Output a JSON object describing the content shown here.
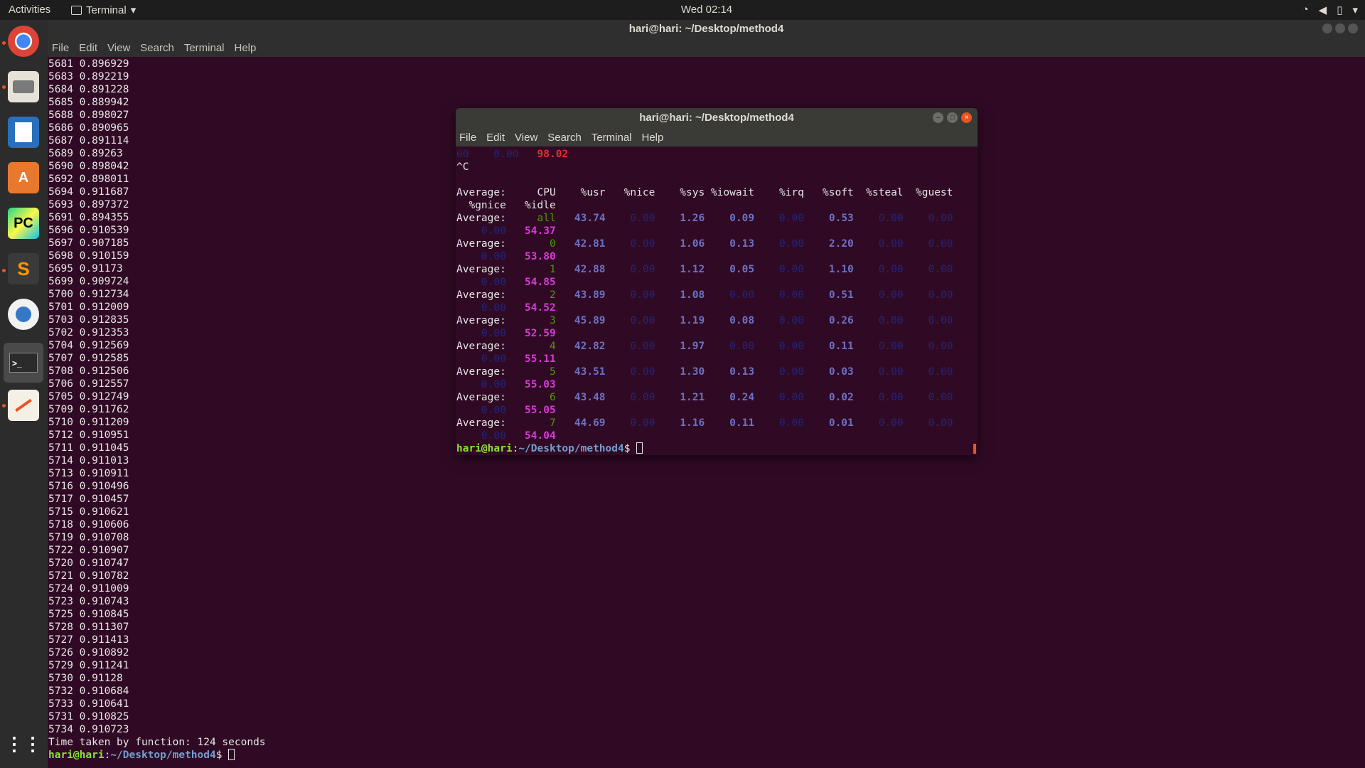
{
  "topbar": {
    "activities": "Activities",
    "app_name": "Terminal",
    "clock": "Wed 02:14"
  },
  "dock": {
    "items": [
      {
        "name": "chrome",
        "label": ""
      },
      {
        "name": "files",
        "label": ""
      },
      {
        "name": "writer",
        "label": ""
      },
      {
        "name": "software",
        "label": ""
      },
      {
        "name": "pycharm",
        "label": "PC"
      },
      {
        "name": "sublime",
        "label": "S"
      },
      {
        "name": "android-studio",
        "label": ""
      },
      {
        "name": "terminal",
        "label": ""
      },
      {
        "name": "text-editor",
        "label": ""
      }
    ],
    "colors": {
      "accent": "#e95420"
    }
  },
  "bg_window": {
    "title": "hari@hari: ~/Desktop/method4",
    "menu": [
      "File",
      "Edit",
      "View",
      "Search",
      "Terminal",
      "Help"
    ],
    "lines": [
      "5681 0.896929",
      "5683 0.892219",
      "5684 0.891228",
      "5685 0.889942",
      "5688 0.898027",
      "5686 0.890965",
      "5687 0.891114",
      "5689 0.89263",
      "5690 0.898042",
      "5692 0.898011",
      "5694 0.911687",
      "5693 0.897372",
      "5691 0.894355",
      "5696 0.910539",
      "5697 0.907185",
      "5698 0.910159",
      "5695 0.91173",
      "5699 0.909724",
      "5700 0.912734",
      "5701 0.912009",
      "5703 0.912835",
      "5702 0.912353",
      "5704 0.912569",
      "5707 0.912585",
      "5708 0.912506",
      "5706 0.912557",
      "5705 0.912749",
      "5709 0.911762",
      "5710 0.911209",
      "5712 0.910951",
      "5711 0.911045",
      "5714 0.911013",
      "5713 0.910911",
      "5716 0.910496",
      "5717 0.910457",
      "5715 0.910621",
      "5718 0.910606",
      "5719 0.910708",
      "5722 0.910907",
      "5720 0.910747",
      "5721 0.910782",
      "5724 0.911009",
      "5723 0.910743",
      "5725 0.910845",
      "5728 0.911307",
      "5727 0.911413",
      "5726 0.910892",
      "5729 0.911241",
      "5730 0.91128",
      "5732 0.910684",
      "5733 0.910641",
      "5731 0.910825",
      "5734 0.910723",
      "Time taken by function: 124 seconds"
    ],
    "prompt_user": "hari@hari",
    "prompt_sep": ":",
    "prompt_path": "~/Desktop/method4",
    "prompt_end": "$ "
  },
  "fg_window": {
    "title": "hari@hari: ~/Desktop/method4",
    "menu": [
      "File",
      "Edit",
      "View",
      "Search",
      "Terminal",
      "Help"
    ],
    "first_line": {
      "a": "00",
      "b": "0.00",
      "c": "98.02"
    },
    "interrupt": "^C",
    "header1": "Average:     CPU    %usr   %nice    %sys %iowait    %irq   %soft  %steal  %guest",
    "header2": "  %gnice   %idle",
    "rows": [
      {
        "label": "Average:",
        "cpu": "all",
        "usr": "43.74",
        "nice": "0.00",
        "sys": "1.26",
        "iowait": "0.09",
        "irq": "0.00",
        "soft": "0.53",
        "steal": "0.00",
        "guest": "0.00",
        "gnice": "0.00",
        "idle": "54.37"
      },
      {
        "label": "Average:",
        "cpu": "0",
        "usr": "42.81",
        "nice": "0.00",
        "sys": "1.06",
        "iowait": "0.13",
        "irq": "0.00",
        "soft": "2.20",
        "steal": "0.00",
        "guest": "0.00",
        "gnice": "0.00",
        "idle": "53.80"
      },
      {
        "label": "Average:",
        "cpu": "1",
        "usr": "42.88",
        "nice": "0.00",
        "sys": "1.12",
        "iowait": "0.05",
        "irq": "0.00",
        "soft": "1.10",
        "steal": "0.00",
        "guest": "0.00",
        "gnice": "0.00",
        "idle": "54.85"
      },
      {
        "label": "Average:",
        "cpu": "2",
        "usr": "43.89",
        "nice": "0.00",
        "sys": "1.08",
        "iowait": "0.00",
        "irq": "0.00",
        "soft": "0.51",
        "steal": "0.00",
        "guest": "0.00",
        "gnice": "0.00",
        "idle": "54.52"
      },
      {
        "label": "Average:",
        "cpu": "3",
        "usr": "45.89",
        "nice": "0.00",
        "sys": "1.19",
        "iowait": "0.08",
        "irq": "0.00",
        "soft": "0.26",
        "steal": "0.00",
        "guest": "0.00",
        "gnice": "0.00",
        "idle": "52.59"
      },
      {
        "label": "Average:",
        "cpu": "4",
        "usr": "42.82",
        "nice": "0.00",
        "sys": "1.97",
        "iowait": "0.00",
        "irq": "0.00",
        "soft": "0.11",
        "steal": "0.00",
        "guest": "0.00",
        "gnice": "0.00",
        "idle": "55.11"
      },
      {
        "label": "Average:",
        "cpu": "5",
        "usr": "43.51",
        "nice": "0.00",
        "sys": "1.30",
        "iowait": "0.13",
        "irq": "0.00",
        "soft": "0.03",
        "steal": "0.00",
        "guest": "0.00",
        "gnice": "0.00",
        "idle": "55.03"
      },
      {
        "label": "Average:",
        "cpu": "6",
        "usr": "43.48",
        "nice": "0.00",
        "sys": "1.21",
        "iowait": "0.24",
        "irq": "0.00",
        "soft": "0.02",
        "steal": "0.00",
        "guest": "0.00",
        "gnice": "0.00",
        "idle": "55.05"
      },
      {
        "label": "Average:",
        "cpu": "7",
        "usr": "44.69",
        "nice": "0.00",
        "sys": "1.16",
        "iowait": "0.11",
        "irq": "0.00",
        "soft": "0.01",
        "steal": "0.00",
        "guest": "0.00",
        "gnice": "0.00",
        "idle": "54.04"
      }
    ],
    "prompt_user": "hari@hari",
    "prompt_sep": ":",
    "prompt_path": "~/Desktop/method4",
    "prompt_end": "$ "
  }
}
